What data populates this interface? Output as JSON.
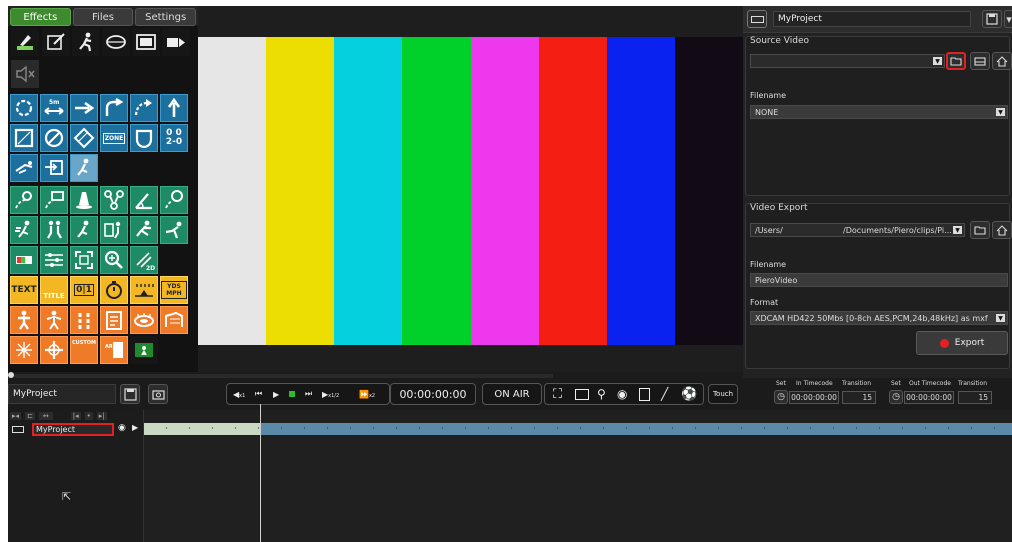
{
  "tabs": [
    "Effects",
    "Files",
    "Settings"
  ],
  "palette": {
    "row1": [
      "draw-icon",
      "edit-pen-icon",
      "player-run-icon",
      "ellipse-icon",
      "film-icon",
      "arrow-right-icon"
    ],
    "row2": [
      "speaker-mute-icon"
    ],
    "row3": [
      "circle-dotted-icon",
      "arrow-double-icon",
      "arrow-right-icon",
      "curved-arrow-icon",
      "dotted-curved-arrow-icon",
      "arrow-up-icon"
    ],
    "row4_labels": {
      "zone": "ZONE",
      "score": "0 0\n2-0"
    },
    "row6_labels": {},
    "row9_labels": {
      "text": "TEXT",
      "title": "TITLE",
      "score": "0|1",
      "yds": "YDS MPH"
    },
    "row11_labels": {
      "custom": "CUSTOM"
    }
  },
  "preview": {
    "bars": [
      "#e6e6e6",
      "#ebde00",
      "#05d0dd",
      "#00d02a",
      "#ee38ee",
      "#f41e12",
      "#0a22f0",
      "#120a14"
    ]
  },
  "right": {
    "project_name": "MyProject",
    "source_video": {
      "title": "Source Video",
      "select_value": "",
      "filename_label": "Filename",
      "filename_value": "NONE"
    },
    "video_export": {
      "title": "Video Export",
      "path_left": "/Users/",
      "path_right": "/Documents/Piero/clips/Pi...",
      "filename_label": "Filename",
      "filename_value": "PieroVideo",
      "format_label": "Format",
      "format_value": "XDCAM HD422 50Mbs [0-8ch AES,PCM,24b,48kHz] as mxf",
      "export_label": "Export"
    }
  },
  "transport": {
    "project_name": "MyProject",
    "speed_back": "x1",
    "speed_half": "x1/2",
    "speed_fwd": "x2",
    "timecode": "00:00:00:00",
    "on_air": "ON AIR",
    "touch": "Touch",
    "in": {
      "set": "Set",
      "tc_label": "In Timecode",
      "trans_label": "Transition",
      "tc": "00:00:00:00",
      "trans": "15"
    },
    "out": {
      "set": "Set",
      "tc_label": "Out Timecode",
      "trans_label": "Transition",
      "tc": "00:00:00:00",
      "trans": "15"
    }
  },
  "timeline": {
    "track_name": "MyProject"
  },
  "colors": {
    "accent_green": "#3e8a2e",
    "highlight_red": "#e12222",
    "record_red": "#e62020",
    "track_blue": "#5a8aa8"
  }
}
